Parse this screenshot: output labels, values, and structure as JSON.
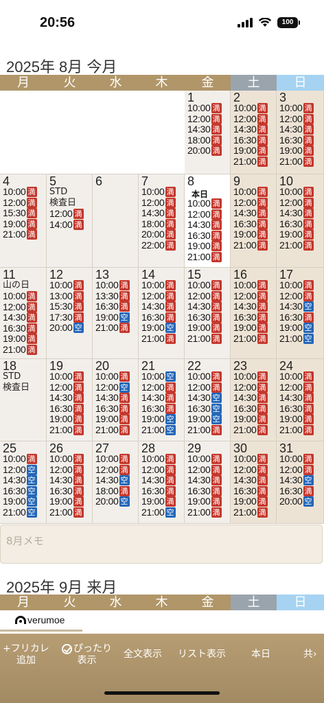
{
  "status_bar": {
    "time": "20:56",
    "battery": "100"
  },
  "current_month": {
    "title": "2025年 8月 今月"
  },
  "next_month": {
    "title": "2025年 9月 来月"
  },
  "weekdays": [
    "月",
    "火",
    "水",
    "木",
    "金",
    "土",
    "日"
  ],
  "weekday_colors": {
    "weekday": "#b09669",
    "saturday": "#9aa4ad",
    "sunday": "#a6d3f2"
  },
  "status_colors": {
    "full": "#c4362b",
    "open": "#2467b8"
  },
  "today_label": "本日",
  "days": [
    {
      "day": "1",
      "slots": [
        [
          "10:00",
          "満"
        ],
        [
          "12:00",
          "満"
        ],
        [
          "14:30",
          "満"
        ],
        [
          "18:00",
          "満"
        ],
        [
          "20:00",
          "満"
        ]
      ]
    },
    {
      "day": "2",
      "slots": [
        [
          "10:00",
          "満"
        ],
        [
          "12:00",
          "満"
        ],
        [
          "14:30",
          "満"
        ],
        [
          "16:30",
          "満"
        ],
        [
          "19:00",
          "満"
        ],
        [
          "21:00",
          "満"
        ]
      ]
    },
    {
      "day": "3",
      "slots": [
        [
          "10:00",
          "満"
        ],
        [
          "12:00",
          "満"
        ],
        [
          "14:30",
          "満"
        ],
        [
          "16:30",
          "満"
        ],
        [
          "19:00",
          "満"
        ],
        [
          "21:00",
          "満"
        ]
      ]
    },
    {
      "day": "4",
      "slots": [
        [
          "10:00",
          "満"
        ],
        [
          "12:00",
          "満"
        ],
        [
          "15:30",
          "満"
        ],
        [
          "19:00",
          "満"
        ],
        [
          "21:00",
          "満"
        ]
      ]
    },
    {
      "day": "5",
      "note": [
        "STD",
        "検査日"
      ],
      "slots": [
        [
          "12:00",
          "満"
        ],
        [
          "14:00",
          "満"
        ]
      ]
    },
    {
      "day": "6",
      "slots": []
    },
    {
      "day": "7",
      "slots": [
        [
          "10:00",
          "満"
        ],
        [
          "12:00",
          "満"
        ],
        [
          "14:30",
          "満"
        ],
        [
          "18:00",
          "満"
        ],
        [
          "20:00",
          "満"
        ],
        [
          "22:00",
          "満"
        ]
      ]
    },
    {
      "day": "8",
      "today": true,
      "slots": [
        [
          "10:00",
          "満"
        ],
        [
          "12:00",
          "満"
        ],
        [
          "14:30",
          "満"
        ],
        [
          "16:30",
          "満"
        ],
        [
          "19:00",
          "満"
        ],
        [
          "21:00",
          "満"
        ]
      ]
    },
    {
      "day": "9",
      "slots": [
        [
          "10:00",
          "満"
        ],
        [
          "12:00",
          "満"
        ],
        [
          "14:30",
          "満"
        ],
        [
          "16:30",
          "満"
        ],
        [
          "19:00",
          "満"
        ],
        [
          "21:00",
          "満"
        ]
      ]
    },
    {
      "day": "10",
      "slots": [
        [
          "10:00",
          "満"
        ],
        [
          "12:00",
          "満"
        ],
        [
          "14:30",
          "満"
        ],
        [
          "16:30",
          "満"
        ],
        [
          "19:00",
          "満"
        ],
        [
          "21:00",
          "満"
        ]
      ]
    },
    {
      "day": "11",
      "note": [
        "山の日"
      ],
      "slots": [
        [
          "10:00",
          "満"
        ],
        [
          "12:00",
          "満"
        ],
        [
          "14:30",
          "満"
        ],
        [
          "16:30",
          "満"
        ],
        [
          "19:00",
          "満"
        ],
        [
          "21:00",
          "満"
        ]
      ]
    },
    {
      "day": "12",
      "slots": [
        [
          "10:00",
          "満"
        ],
        [
          "13:00",
          "満"
        ],
        [
          "15:30",
          "満"
        ],
        [
          "17:30",
          "満"
        ],
        [
          "20:00",
          "空"
        ]
      ]
    },
    {
      "day": "13",
      "slots": [
        [
          "10:00",
          "満"
        ],
        [
          "13:30",
          "満"
        ],
        [
          "16:30",
          "満"
        ],
        [
          "19:00",
          "空"
        ],
        [
          "21:00",
          "満"
        ]
      ]
    },
    {
      "day": "14",
      "slots": [
        [
          "10:00",
          "満"
        ],
        [
          "12:00",
          "満"
        ],
        [
          "14:30",
          "満"
        ],
        [
          "16:30",
          "満"
        ],
        [
          "19:00",
          "空"
        ],
        [
          "21:00",
          "満"
        ]
      ]
    },
    {
      "day": "15",
      "slots": [
        [
          "10:00",
          "満"
        ],
        [
          "12:00",
          "満"
        ],
        [
          "14:30",
          "満"
        ],
        [
          "16:30",
          "満"
        ],
        [
          "19:00",
          "満"
        ],
        [
          "21:00",
          "満"
        ]
      ]
    },
    {
      "day": "16",
      "slots": [
        [
          "10:00",
          "満"
        ],
        [
          "12:00",
          "満"
        ],
        [
          "14:30",
          "満"
        ],
        [
          "16:30",
          "満"
        ],
        [
          "19:00",
          "満"
        ],
        [
          "21:00",
          "満"
        ]
      ]
    },
    {
      "day": "17",
      "slots": [
        [
          "10:00",
          "満"
        ],
        [
          "12:00",
          "満"
        ],
        [
          "14:30",
          "空"
        ],
        [
          "16:30",
          "満"
        ],
        [
          "19:00",
          "空"
        ],
        [
          "21:00",
          "空"
        ]
      ]
    },
    {
      "day": "18",
      "note": [
        "STD",
        "検査日"
      ],
      "slots": []
    },
    {
      "day": "19",
      "slots": [
        [
          "10:00",
          "満"
        ],
        [
          "12:00",
          "満"
        ],
        [
          "14:30",
          "満"
        ],
        [
          "16:30",
          "満"
        ],
        [
          "19:00",
          "満"
        ],
        [
          "21:00",
          "満"
        ]
      ]
    },
    {
      "day": "20",
      "slots": [
        [
          "10:00",
          "満"
        ],
        [
          "12:00",
          "空"
        ],
        [
          "14:30",
          "満"
        ],
        [
          "16:30",
          "満"
        ],
        [
          "19:00",
          "満"
        ],
        [
          "21:00",
          "満"
        ]
      ]
    },
    {
      "day": "21",
      "slots": [
        [
          "10:00",
          "空"
        ],
        [
          "12:00",
          "満"
        ],
        [
          "14:30",
          "満"
        ],
        [
          "16:30",
          "満"
        ],
        [
          "19:00",
          "空"
        ],
        [
          "21:00",
          "空"
        ]
      ]
    },
    {
      "day": "22",
      "slots": [
        [
          "10:00",
          "満"
        ],
        [
          "12:00",
          "満"
        ],
        [
          "14:30",
          "空"
        ],
        [
          "16:30",
          "空"
        ],
        [
          "19:00",
          "空"
        ],
        [
          "21:00",
          "満"
        ]
      ]
    },
    {
      "day": "23",
      "slots": [
        [
          "10:00",
          "満"
        ],
        [
          "12:00",
          "満"
        ],
        [
          "14:30",
          "満"
        ],
        [
          "16:30",
          "満"
        ],
        [
          "19:00",
          "満"
        ],
        [
          "21:00",
          "満"
        ]
      ]
    },
    {
      "day": "24",
      "slots": [
        [
          "10:00",
          "満"
        ],
        [
          "12:00",
          "満"
        ],
        [
          "14:30",
          "満"
        ],
        [
          "16:30",
          "満"
        ],
        [
          "19:00",
          "満"
        ],
        [
          "21:00",
          "満"
        ]
      ]
    },
    {
      "day": "25",
      "slots": [
        [
          "10:00",
          "満"
        ],
        [
          "12:00",
          "空"
        ],
        [
          "14:30",
          "空"
        ],
        [
          "16:30",
          "空"
        ],
        [
          "19:00",
          "空"
        ],
        [
          "21:00",
          "空"
        ]
      ]
    },
    {
      "day": "26",
      "slots": [
        [
          "10:00",
          "満"
        ],
        [
          "12:00",
          "満"
        ],
        [
          "14:30",
          "満"
        ],
        [
          "16:30",
          "満"
        ],
        [
          "19:00",
          "満"
        ],
        [
          "21:00",
          "満"
        ]
      ]
    },
    {
      "day": "27",
      "slots": [
        [
          "10:00",
          "満"
        ],
        [
          "12:00",
          "満"
        ],
        [
          "14:30",
          "空"
        ],
        [
          "18:00",
          "満"
        ],
        [
          "20:00",
          "空"
        ]
      ]
    },
    {
      "day": "28",
      "slots": [
        [
          "10:00",
          "満"
        ],
        [
          "12:00",
          "満"
        ],
        [
          "14:30",
          "満"
        ],
        [
          "16:30",
          "満"
        ],
        [
          "19:00",
          "満"
        ],
        [
          "21:00",
          "空"
        ]
      ]
    },
    {
      "day": "29",
      "slots": [
        [
          "10:00",
          "満"
        ],
        [
          "12:00",
          "満"
        ],
        [
          "14:30",
          "満"
        ],
        [
          "16:30",
          "満"
        ],
        [
          "19:00",
          "満"
        ],
        [
          "21:00",
          "満"
        ]
      ]
    },
    {
      "day": "30",
      "slots": [
        [
          "10:00",
          "満"
        ],
        [
          "12:00",
          "満"
        ],
        [
          "14:30",
          "満"
        ],
        [
          "16:30",
          "満"
        ],
        [
          "19:00",
          "満"
        ],
        [
          "21:00",
          "満"
        ]
      ]
    },
    {
      "day": "31",
      "slots": [
        [
          "10:00",
          "満"
        ],
        [
          "12:00",
          "満"
        ],
        [
          "14:30",
          "空"
        ],
        [
          "16:30",
          "満"
        ],
        [
          "20:00",
          "空"
        ]
      ]
    }
  ],
  "memo": {
    "placeholder": "8月メモ"
  },
  "logo": {
    "text": "verumoe"
  },
  "toolbar": {
    "add_furigana": [
      "+フリカレ",
      "追加"
    ],
    "fit": [
      "ぴったり",
      "表示"
    ],
    "full_text": "全文表示",
    "list_view": "リスト表示",
    "today": "本日",
    "share": "共"
  }
}
